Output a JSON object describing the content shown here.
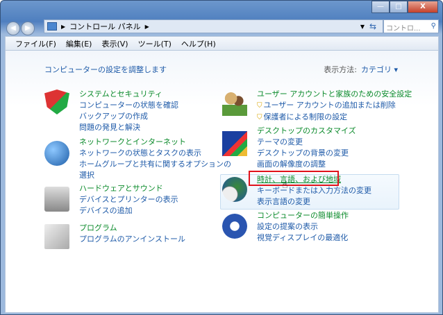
{
  "window": {
    "minimize": "—",
    "maximize": "□",
    "close": "X"
  },
  "address": {
    "path": "コントロール パネル",
    "search_placeholder": "コントロ..."
  },
  "menu": [
    "ファイル(F)",
    "編集(E)",
    "表示(V)",
    "ツール(T)",
    "ヘルプ(H)"
  ],
  "header": {
    "hint": "コンピューターの設定を調整します",
    "view_label": "表示方法:",
    "view_value": "カテゴリ ▾"
  },
  "left": [
    {
      "title": "システムとセキュリティ",
      "links": [
        "コンピューターの状態を確認",
        "バックアップの作成",
        "問題の発見と解決"
      ]
    },
    {
      "title": "ネットワークとインターネット",
      "links": [
        "ネットワークの状態とタスクの表示",
        "ホームグループと共有に関するオプションの",
        "選択"
      ]
    },
    {
      "title": "ハードウェアとサウンド",
      "links": [
        "デバイスとプリンターの表示",
        "デバイスの追加"
      ]
    },
    {
      "title": "プログラム",
      "links": [
        "プログラムのアンインストール"
      ]
    }
  ],
  "right": [
    {
      "title": "ユーザー アカウントと家族のための安全設定",
      "links": [
        "ユーザー アカウントの追加または削除",
        "保護者による制限の設定"
      ]
    },
    {
      "title": "デスクトップのカスタマイズ",
      "links": [
        "テーマの変更",
        "デスクトップの背景の変更",
        "画面の解像度の調整"
      ]
    },
    {
      "title": "時計、言語、および地域",
      "links": [
        "キーボードまたは入力方法の変更",
        "表示言語の変更"
      ]
    },
    {
      "title": "コンピューターの簡単操作",
      "links": [
        "設定の提案の表示",
        "視覚ディスプレイの最適化"
      ]
    }
  ]
}
